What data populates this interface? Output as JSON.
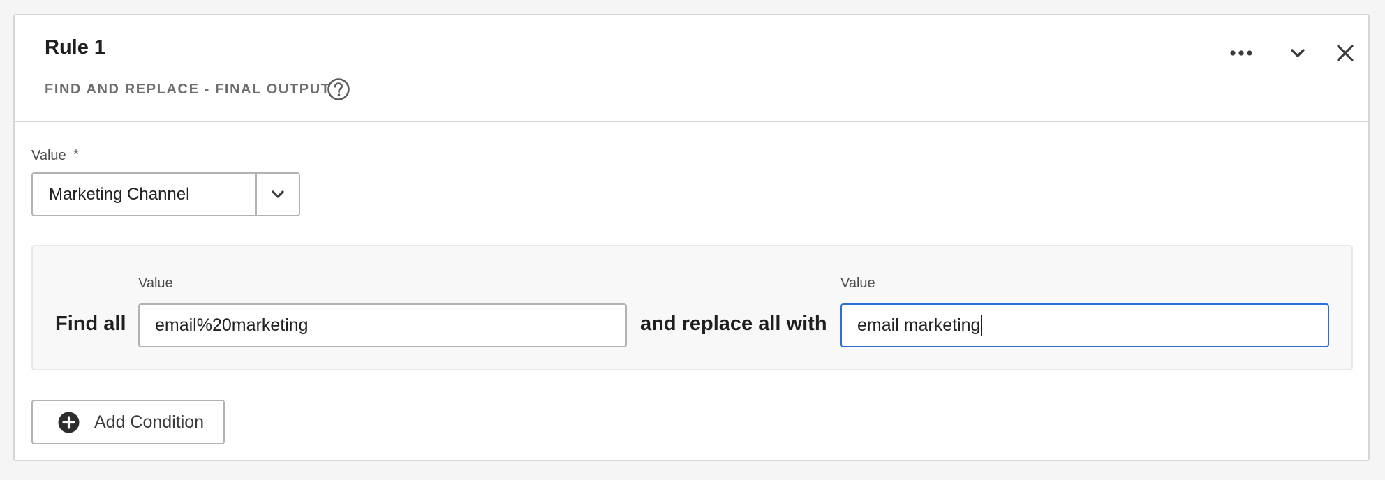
{
  "rule": {
    "title": "Rule 1",
    "subtitle": "FIND AND REPLACE - FINAL OUTPUT"
  },
  "header_actions": {
    "more_icon": "more-horizontal-icon",
    "collapse_icon": "chevron-down-icon",
    "close_icon": "close-icon",
    "help_icon": "help-circle-icon"
  },
  "value_field": {
    "label": "Value",
    "required_marker": "*",
    "selected": "Marketing Channel"
  },
  "condition": {
    "find_label": "Find all",
    "find_field_label": "Value",
    "find_value": "email%20marketing",
    "replace_label": "and replace all with",
    "replace_field_label": "Value",
    "replace_value": "email marketing"
  },
  "add_condition": {
    "label": "Add Condition",
    "icon": "add-circle-icon"
  },
  "colors": {
    "focus_border": "#2d6fd6",
    "border": "#b3b3b3",
    "text": "#222222",
    "muted": "#6e6e6e"
  }
}
